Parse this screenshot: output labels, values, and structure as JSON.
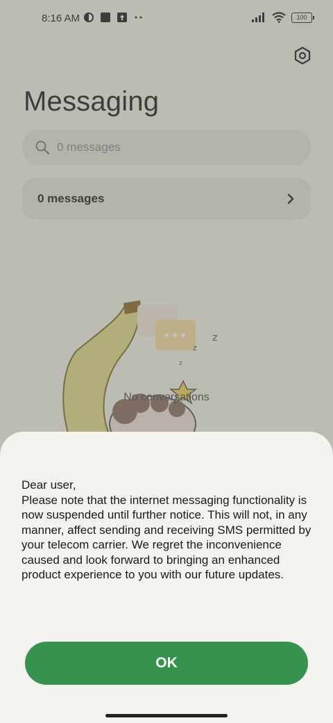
{
  "status_bar": {
    "time": "8:16 AM",
    "battery": "100",
    "icons": [
      "tracker-icon",
      "square-icon",
      "upload-icon",
      "more-dots-icon",
      "signal-icon",
      "wifi-icon",
      "battery-icon"
    ]
  },
  "header": {
    "title": "Messaging",
    "settings_icon": "settings-hex-icon"
  },
  "search": {
    "placeholder": "0 messages"
  },
  "messages_row": {
    "label": "0 messages"
  },
  "empty_state": {
    "label": "No conversations"
  },
  "dialog": {
    "text": "Dear user,\nPlease note that the internet messaging functionality is now suspended until further notice. This will not, in any manner, affect sending and receiving SMS permitted by your telecom carrier. We regret the inconvenience caused and look forward to bringing an enhanced product experience to you with our future updates.",
    "ok_label": "OK"
  },
  "colors": {
    "accent": "#36934f",
    "background": "#f4f3ee",
    "card": "#e8e7e1"
  }
}
